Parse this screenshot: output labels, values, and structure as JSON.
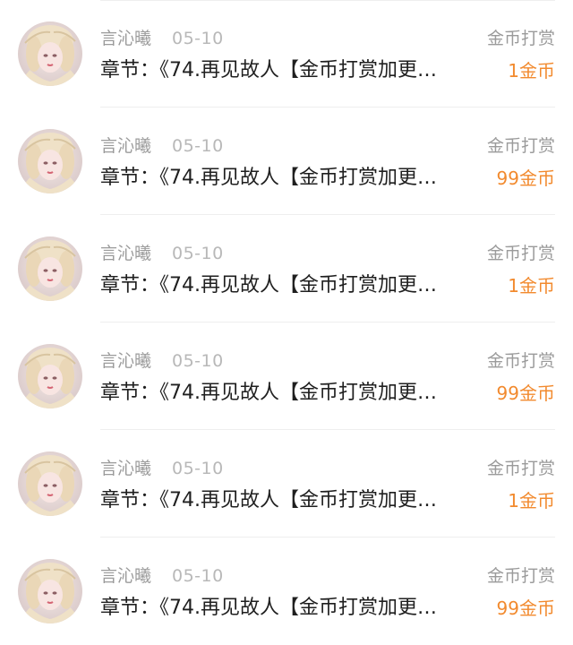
{
  "records": [
    {
      "user": "言沁曦",
      "date": "05-10",
      "type": "金币打赏",
      "chapter": "章节：《74.再见故人【金币打赏加更…",
      "amount": "1金币"
    },
    {
      "user": "言沁曦",
      "date": "05-10",
      "type": "金币打赏",
      "chapter": "章节：《74.再见故人【金币打赏加更…",
      "amount": "99金币"
    },
    {
      "user": "言沁曦",
      "date": "05-10",
      "type": "金币打赏",
      "chapter": "章节：《74.再见故人【金币打赏加更…",
      "amount": "1金币"
    },
    {
      "user": "言沁曦",
      "date": "05-10",
      "type": "金币打赏",
      "chapter": "章节：《74.再见故人【金币打赏加更…",
      "amount": "99金币"
    },
    {
      "user": "言沁曦",
      "date": "05-10",
      "type": "金币打赏",
      "chapter": "章节：《74.再见故人【金币打赏加更…",
      "amount": "1金币"
    },
    {
      "user": "言沁曦",
      "date": "05-10",
      "type": "金币打赏",
      "chapter": "章节：《74.再见故人【金币打赏加更…",
      "amount": "99金币"
    }
  ],
  "icons": {
    "avatar": "user-avatar-icon"
  },
  "colors": {
    "amount": "#f28a2e",
    "secondary_text": "#9b9b9b",
    "date_text": "#b8b8b8",
    "primary_text": "#1f1f1f"
  }
}
